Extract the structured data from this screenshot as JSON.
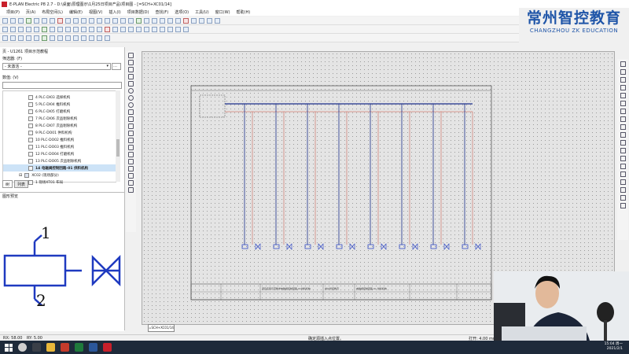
{
  "window": {
    "title": "E-PLAN Electric P8 2.7 - D:\\桌面\\原理图示\\1月25日项目产品\\项目图 - [=SCH+XC01/14]"
  },
  "menu": [
    "项目(P)",
    "页(A)",
    "布局空间(L)",
    "编辑(E)",
    "视图(V)",
    "插入(I)",
    "项目数据(D)",
    "查找(F)",
    "选项(O)",
    "工具(U)",
    "窗口(W)",
    "帮助(H)"
  ],
  "brand": {
    "cn": "常州智控教育",
    "en": "CHANGZHOU ZK EDUCATION"
  },
  "page_panel": {
    "title": "页 - U1261 项目示范教程",
    "filter_label": "筛选器: (F)",
    "filter_value": "- 未激活 -",
    "value_label": "数值: (V)",
    "tree": [
      {
        "label": "4 PLC-DI03 选择机构",
        "selected": false
      },
      {
        "label": "5 PLC-DI04 推料机构",
        "selected": false
      },
      {
        "label": "6 PLC-DI05 打磨机构",
        "selected": false
      },
      {
        "label": "7 PLC-DI06 次品剔除机构",
        "selected": false
      },
      {
        "label": "8 PLC-DI07 次品剔除机构",
        "selected": false
      },
      {
        "label": "9 PLC-DO01 供料机构",
        "selected": false
      },
      {
        "label": "10 PLC-DO02 推料机构",
        "selected": false
      },
      {
        "label": "11 PLC-DO03 推料机构",
        "selected": false
      },
      {
        "label": "12 PLC-DO04 打磨机构",
        "selected": false
      },
      {
        "label": "13 PLC-DO05 次品剔除机构",
        "selected": false
      },
      {
        "label": "14 电磁阀控制回路-01 供料机构",
        "selected": true
      },
      {
        "label": "XC02 (现场部分)",
        "selected": false
      },
      {
        "label": "1 现场XT01 布局",
        "selected": false
      }
    ],
    "tabs": [
      "树",
      "列表"
    ]
  },
  "preview": {
    "title": "图形预览",
    "pin1": "1",
    "pin2": "2"
  },
  "canvas": {
    "sheet_tab": "=SCH+XC01/14",
    "valve_count": 8,
    "titleblock_text": [
      "项目名称示范教学电磁阀控制回路-01供料机构",
      "常州智控教育",
      "电磁阀控制回路-01 供料机构"
    ]
  },
  "status": {
    "left_x": "RX: 58.00",
    "left_y": "RY: 5.00",
    "center": "确定源插入点位置。",
    "right": "打开: 4.00 mm"
  },
  "taskbar": {
    "time": "15:04 周一",
    "date": "2021/2/1"
  },
  "colors": {
    "accent": "#1f55a8",
    "wire_red": "#c74b3a",
    "wire_blue": "#1b2f8a",
    "valve_blue": "#1f3ac0"
  }
}
